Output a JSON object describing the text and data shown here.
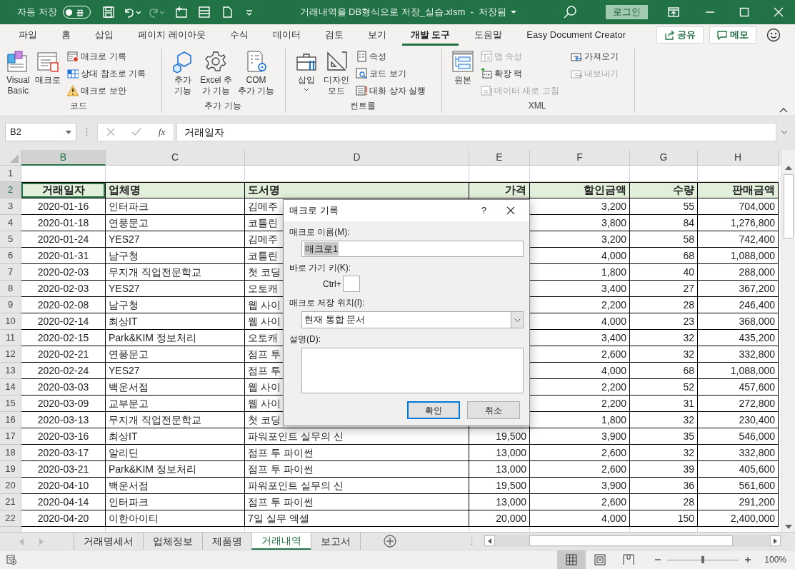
{
  "title_bar": {
    "autosave_label": "자동 저장",
    "autosave_on": false,
    "autosave_state": "끔",
    "filename": "거래내역을 DB형식으로 저장_실습.xlsm  -  저장됨",
    "login": "로그인"
  },
  "ribbon_tabs": [
    {
      "label": "파일",
      "selected": false
    },
    {
      "label": "홈",
      "selected": false
    },
    {
      "label": "삽입",
      "selected": false
    },
    {
      "label": "페이지 레이아웃",
      "selected": false
    },
    {
      "label": "수식",
      "selected": false
    },
    {
      "label": "데이터",
      "selected": false
    },
    {
      "label": "검토",
      "selected": false
    },
    {
      "label": "보기",
      "selected": false
    },
    {
      "label": "개발 도구",
      "selected": true
    },
    {
      "label": "도움말",
      "selected": false
    },
    {
      "label": "Easy Document Creator",
      "selected": false
    }
  ],
  "share": "공유",
  "comments": "메모",
  "ribbon_groups": [
    {
      "label": "코드",
      "large": [
        {
          "label": "Visual\nBasic",
          "dropdown": false
        },
        {
          "label": "매크로",
          "dropdown": false
        }
      ],
      "small_columns": [
        [
          {
            "label": "매크로 기록",
            "disabled": false
          },
          {
            "label": "상대 참조로 기록",
            "disabled": false
          },
          {
            "label": "매크로 보안",
            "disabled": false
          }
        ]
      ]
    },
    {
      "label": "추가 기능",
      "large": [
        {
          "label": "추가\n기능",
          "dropdown": false
        },
        {
          "label": "Excel 추\n가 기능",
          "dropdown": false
        },
        {
          "label": "COM\n추가 기능",
          "dropdown": false
        }
      ]
    },
    {
      "label": "컨트롤",
      "large": [
        {
          "label": "삽입",
          "dropdown": true
        },
        {
          "label": "디자인\n모드",
          "dropdown": false
        }
      ],
      "small_columns": [
        [
          {
            "label": "속성",
            "disabled": false
          },
          {
            "label": "코드 보기",
            "disabled": false
          },
          {
            "label": "대화 상자 실행",
            "disabled": false
          }
        ]
      ]
    },
    {
      "label": "XML",
      "large": [
        {
          "label": "원본",
          "dropdown": false
        }
      ],
      "small_columns": [
        [
          {
            "label": "맵 속성",
            "disabled": true
          },
          {
            "label": "확장 팩",
            "disabled": false
          },
          {
            "label": "데이터 새로 고침",
            "disabled": true
          }
        ],
        [
          {
            "label": "가져오기",
            "disabled": false
          },
          {
            "label": "내보내기",
            "disabled": true
          }
        ]
      ]
    }
  ],
  "formula_bar": {
    "name_box": "B2",
    "fx_label": "fx",
    "formula": "거래일자"
  },
  "columns": [
    {
      "letter": "B",
      "selected": true
    },
    {
      "letter": "C",
      "selected": false
    },
    {
      "letter": "D",
      "selected": false
    },
    {
      "letter": "E",
      "selected": false
    },
    {
      "letter": "F",
      "selected": false
    },
    {
      "letter": "G",
      "selected": false
    },
    {
      "letter": "H",
      "selected": false
    }
  ],
  "rows": [
    {
      "number": "1",
      "selected": false,
      "kind": "empty"
    },
    {
      "number": "2",
      "selected": true,
      "kind": "header",
      "headers": [
        "거래일자",
        "업체명",
        "도서명",
        "가격",
        "할인금액",
        "수량",
        "판매금액"
      ]
    },
    {
      "number": "3",
      "selected": false,
      "kind": "data",
      "date": "2020-01-16",
      "vendor": "인터파크",
      "book": "김메주",
      "discount": "3,200",
      "qty": "55",
      "amount": "704,000"
    },
    {
      "number": "4",
      "selected": false,
      "kind": "data",
      "date": "2020-01-18",
      "vendor": "연풍문고",
      "book": "코틀린",
      "discount": "3,800",
      "qty": "84",
      "amount": "1,276,800"
    },
    {
      "number": "5",
      "selected": false,
      "kind": "data",
      "date": "2020-01-24",
      "vendor": "YES27",
      "book": "김메주",
      "discount": "3,200",
      "qty": "58",
      "amount": "742,400"
    },
    {
      "number": "6",
      "selected": false,
      "kind": "data",
      "date": "2020-01-31",
      "vendor": "남구청",
      "book": "코틀린",
      "discount": "4,000",
      "qty": "68",
      "amount": "1,088,000"
    },
    {
      "number": "7",
      "selected": false,
      "kind": "data",
      "date": "2020-02-03",
      "vendor": "무지개 직업전문학교",
      "book": "첫 코딩",
      "discount": "1,800",
      "qty": "40",
      "amount": "288,000"
    },
    {
      "number": "8",
      "selected": false,
      "kind": "data",
      "date": "2020-02-03",
      "vendor": "YES27",
      "book": "오토캐",
      "discount": "3,400",
      "qty": "27",
      "amount": "367,200"
    },
    {
      "number": "9",
      "selected": false,
      "kind": "data",
      "date": "2020-02-08",
      "vendor": "남구청",
      "book": "웹 사이",
      "discount": "2,200",
      "qty": "28",
      "amount": "246,400"
    },
    {
      "number": "10",
      "selected": false,
      "kind": "data",
      "date": "2020-02-14",
      "vendor": "최상IT",
      "book": "웹 사이",
      "discount": "4,000",
      "qty": "23",
      "amount": "368,000"
    },
    {
      "number": "11",
      "selected": false,
      "kind": "data",
      "date": "2020-02-15",
      "vendor": "Park&KIM 정보처리",
      "book": "오토캐",
      "discount": "3,400",
      "qty": "32",
      "amount": "435,200"
    },
    {
      "number": "12",
      "selected": false,
      "kind": "data",
      "date": "2020-02-21",
      "vendor": "연풍문고",
      "book": "점프 투",
      "discount": "2,600",
      "qty": "32",
      "amount": "332,800"
    },
    {
      "number": "13",
      "selected": false,
      "kind": "data",
      "date": "2020-02-24",
      "vendor": "YES27",
      "book": "점프 투",
      "discount": "4,000",
      "qty": "68",
      "amount": "1,088,000"
    },
    {
      "number": "14",
      "selected": false,
      "kind": "data",
      "date": "2020-03-03",
      "vendor": "백운서점",
      "book": "웹 사이",
      "discount": "2,200",
      "qty": "52",
      "amount": "457,600"
    },
    {
      "number": "15",
      "selected": false,
      "kind": "data",
      "date": "2020-03-09",
      "vendor": "교부문고",
      "book": "웹 사이",
      "discount": "2,200",
      "qty": "31",
      "amount": "272,800"
    },
    {
      "number": "16",
      "selected": false,
      "kind": "data",
      "date": "2020-03-13",
      "vendor": "무지개 직업전문학교",
      "book": "첫 코딩",
      "discount": "1,800",
      "qty": "32",
      "amount": "230,400"
    },
    {
      "number": "17",
      "selected": false,
      "kind": "data",
      "date": "2020-03-16",
      "vendor": "최상IT",
      "book": "파워포인트 실무의 신",
      "price": "19,500",
      "discount": "3,900",
      "qty": "35",
      "amount": "546,000"
    },
    {
      "number": "18",
      "selected": false,
      "kind": "data",
      "date": "2020-03-17",
      "vendor": "알리딘",
      "book": "점프 투 파이썬",
      "price": "13,000",
      "discount": "2,600",
      "qty": "32",
      "amount": "332,800"
    },
    {
      "number": "19",
      "selected": false,
      "kind": "data",
      "date": "2020-03-21",
      "vendor": "Park&KIM 정보처리",
      "book": "점프 투 파이썬",
      "price": "13,000",
      "discount": "2,600",
      "qty": "39",
      "amount": "405,600"
    },
    {
      "number": "20",
      "selected": false,
      "kind": "data",
      "date": "2020-04-10",
      "vendor": "백운서점",
      "book": "파워포인트 실무의 신",
      "price": "19,500",
      "discount": "3,900",
      "qty": "36",
      "amount": "561,600"
    },
    {
      "number": "21",
      "selected": false,
      "kind": "data",
      "date": "2020-04-14",
      "vendor": "인터파크",
      "book": "점프 투 파이썬",
      "price": "13,000",
      "discount": "2,600",
      "qty": "28",
      "amount": "291,200"
    },
    {
      "number": "22",
      "selected": false,
      "kind": "data",
      "date": "2020-04-20",
      "vendor": "이한아이티",
      "book": "7일 실무 엑셀",
      "price": "20,000",
      "discount": "4,000",
      "qty": "150",
      "amount": "2,400,000"
    },
    {
      "number": "",
      "selected": false,
      "kind": "partial"
    }
  ],
  "dialog": {
    "title": "매크로 기록",
    "help": "?",
    "name_label": "매크로 이름(M):",
    "name_value": "매크로1",
    "name_value_selected": true,
    "shortcut_label": "바로 가기 키(K):",
    "ctrl_label": "Ctrl+",
    "store_label": "매크로 저장 위치(I):",
    "store_value": "현재 통합 문서",
    "description_label": "설명(D):",
    "buttons": [
      {
        "label": "확인",
        "default": true
      },
      {
        "label": "취소",
        "default": false
      }
    ]
  },
  "sheet_tabs": [
    {
      "label": "거래명세서",
      "selected": false
    },
    {
      "label": "업체정보",
      "selected": false
    },
    {
      "label": "제품명",
      "selected": false
    },
    {
      "label": "거래내역",
      "selected": true
    },
    {
      "label": "보고서",
      "selected": false
    }
  ],
  "status_bar": {
    "views": [
      {
        "selected": true
      },
      {
        "selected": false
      },
      {
        "selected": false
      }
    ],
    "zoom_slider": {
      "level": 0.5
    },
    "zoom": "100%"
  }
}
